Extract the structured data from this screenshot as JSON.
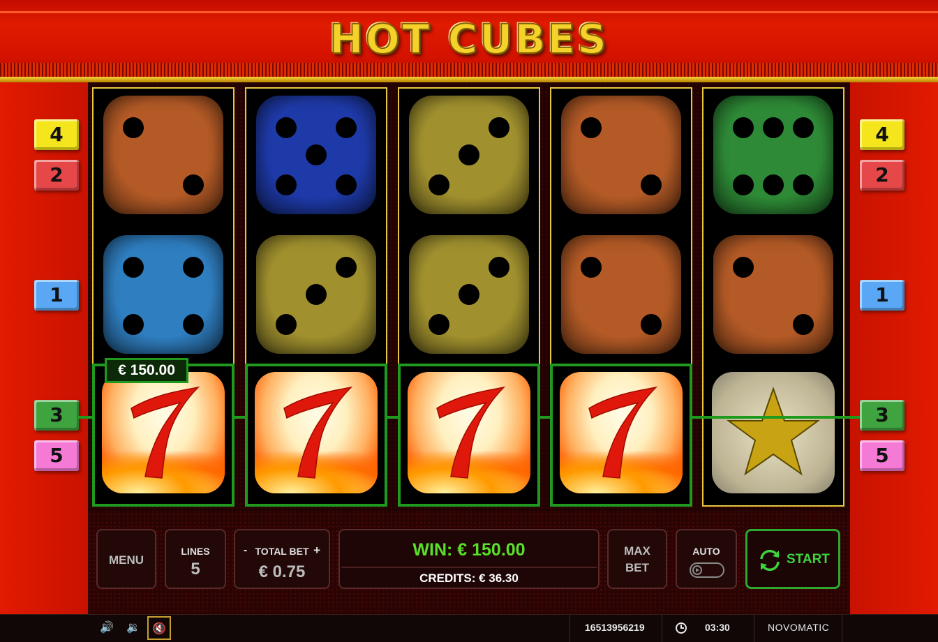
{
  "title": "HOT CUBES",
  "line_badges": {
    "left": [
      {
        "label": "4",
        "color": "#f5e51c"
      },
      {
        "label": "2",
        "color": "#e6484a"
      },
      {
        "label": "1",
        "color": "#5aa8f5"
      },
      {
        "label": "3",
        "color": "#3fa33f"
      },
      {
        "label": "5",
        "color": "#f57ad6"
      }
    ],
    "right": [
      {
        "label": "4",
        "color": "#f5e51c"
      },
      {
        "label": "2",
        "color": "#e6484a"
      },
      {
        "label": "1",
        "color": "#5aa8f5"
      },
      {
        "label": "3",
        "color": "#3fa33f"
      },
      {
        "label": "5",
        "color": "#f57ad6"
      }
    ]
  },
  "reels": [
    [
      {
        "symbol": "die",
        "value": 2,
        "color": "#b35a26"
      },
      {
        "symbol": "die",
        "value": 4,
        "color": "#2f7ec0"
      },
      {
        "symbol": "seven"
      }
    ],
    [
      {
        "symbol": "die",
        "value": 5,
        "color": "#1e3aa8"
      },
      {
        "symbol": "die",
        "value": 3,
        "color": "#a0902e"
      },
      {
        "symbol": "seven"
      }
    ],
    [
      {
        "symbol": "die",
        "value": 3,
        "color": "#a0902e"
      },
      {
        "symbol": "die",
        "value": 3,
        "color": "#a0902e"
      },
      {
        "symbol": "seven"
      }
    ],
    [
      {
        "symbol": "die",
        "value": 2,
        "color": "#b35a26"
      },
      {
        "symbol": "die",
        "value": 2,
        "color": "#b35a26"
      },
      {
        "symbol": "seven"
      }
    ],
    [
      {
        "symbol": "die",
        "value": 6,
        "color": "#2e8a36"
      },
      {
        "symbol": "die",
        "value": 2,
        "color": "#b35a26"
      },
      {
        "symbol": "star"
      }
    ]
  ],
  "win_tag": "€ 150.00",
  "controls": {
    "menu": "MENU",
    "lines_label": "LINES",
    "lines_value": "5",
    "total_bet_label": "TOTAL BET",
    "total_bet_minus": "-",
    "total_bet_plus": "+",
    "total_bet_value": "€ 0.75",
    "win_text": "WIN: € 150.00",
    "credits_text": "CREDITS: € 36.30",
    "max_bet_line1": "MAX",
    "max_bet_line2": "BET",
    "auto_label": "AUTO",
    "start_label": "START"
  },
  "status": {
    "session_id": "16513956219",
    "time": "03:30",
    "brand": "NOVOMATIC"
  },
  "colors": {
    "win_green": "#5ae02a",
    "payline_green": "#1f9a1f",
    "reel_frame_gold": "#e8c840",
    "star_gold": "#c8a414"
  }
}
